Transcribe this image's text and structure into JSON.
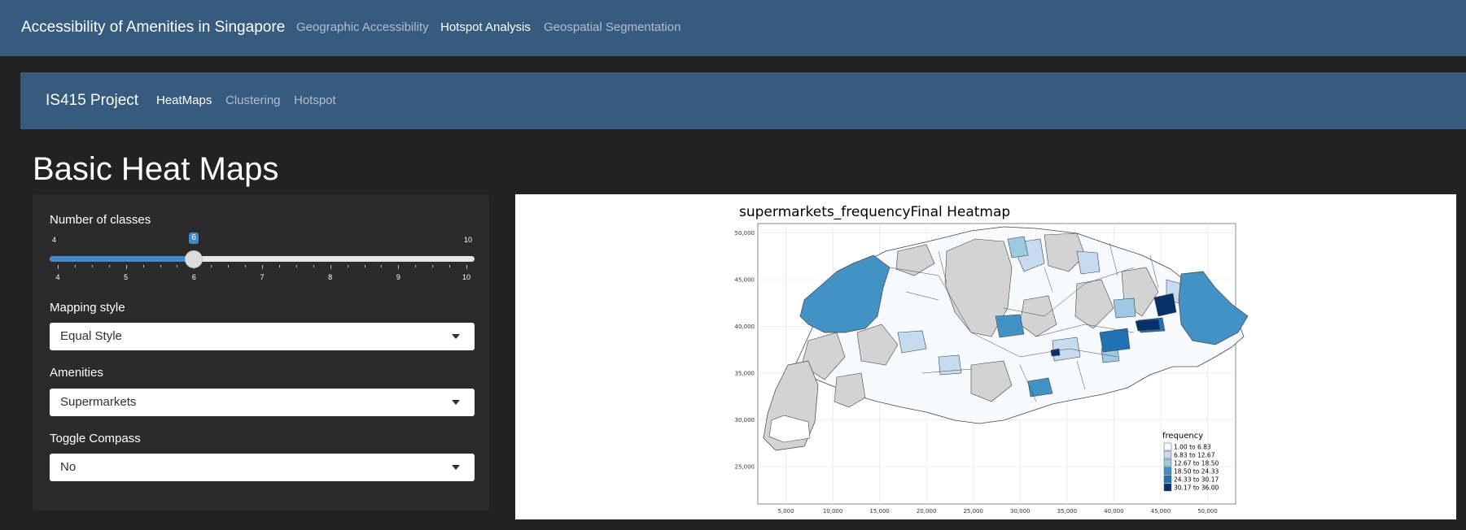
{
  "topnav": {
    "brand": "Accessibility of Amenities in Singapore",
    "links": [
      {
        "label": "Geographic Accessibility",
        "active": false
      },
      {
        "label": "Hotspot Analysis",
        "active": true
      },
      {
        "label": "Geospatial Segmentation",
        "active": false
      }
    ]
  },
  "subnav": {
    "brand": "IS415 Project",
    "links": [
      {
        "label": "HeatMaps",
        "active": true
      },
      {
        "label": "Clustering",
        "active": false
      },
      {
        "label": "Hotspot",
        "active": false
      }
    ]
  },
  "page": {
    "title": "Basic Heat Maps"
  },
  "controls": {
    "classes": {
      "label": "Number of classes",
      "min": "4",
      "max": "10",
      "value": "6",
      "ticks": [
        "4",
        "5",
        "6",
        "7",
        "8",
        "9",
        "10"
      ]
    },
    "mapping_style": {
      "label": "Mapping style",
      "value": "Equal Style"
    },
    "amenities": {
      "label": "Amenities",
      "value": "Supermarkets"
    },
    "toggle_compass": {
      "label": "Toggle Compass",
      "value": "No"
    }
  },
  "chart_data": {
    "type": "choropleth",
    "title": "supermarkets_frequencyFinal Heatmap",
    "x_ticks": [
      "5,000",
      "10,000",
      "15,000",
      "20,000",
      "25,000",
      "30,000",
      "35,000",
      "40,000",
      "45,000",
      "50,000"
    ],
    "y_ticks": [
      "25,000",
      "30,000",
      "35,000",
      "40,000",
      "45,000",
      "50,000"
    ],
    "xlim": [
      2000,
      53000
    ],
    "ylim": [
      21000,
      51000
    ],
    "grid": true,
    "legend": {
      "title": "frequency",
      "placement": "bottom-right",
      "classes": [
        {
          "label": "1.00 to 6.83",
          "color": "#f7fbff"
        },
        {
          "label": "6.83 to 12.67",
          "color": "#c6dbef"
        },
        {
          "label": "12.67 to 18.50",
          "color": "#9ecae1"
        },
        {
          "label": "18.50 to 24.33",
          "color": "#4292c6"
        },
        {
          "label": "24.33 to 30.17",
          "color": "#2171b5"
        },
        {
          "label": "30.17 to 36.00",
          "color": "#08306b"
        }
      ],
      "missing_color": "#d3d3d3"
    }
  },
  "colors": {
    "navbar": "#375a7f",
    "background": "#222222",
    "accent": "#428bca"
  }
}
